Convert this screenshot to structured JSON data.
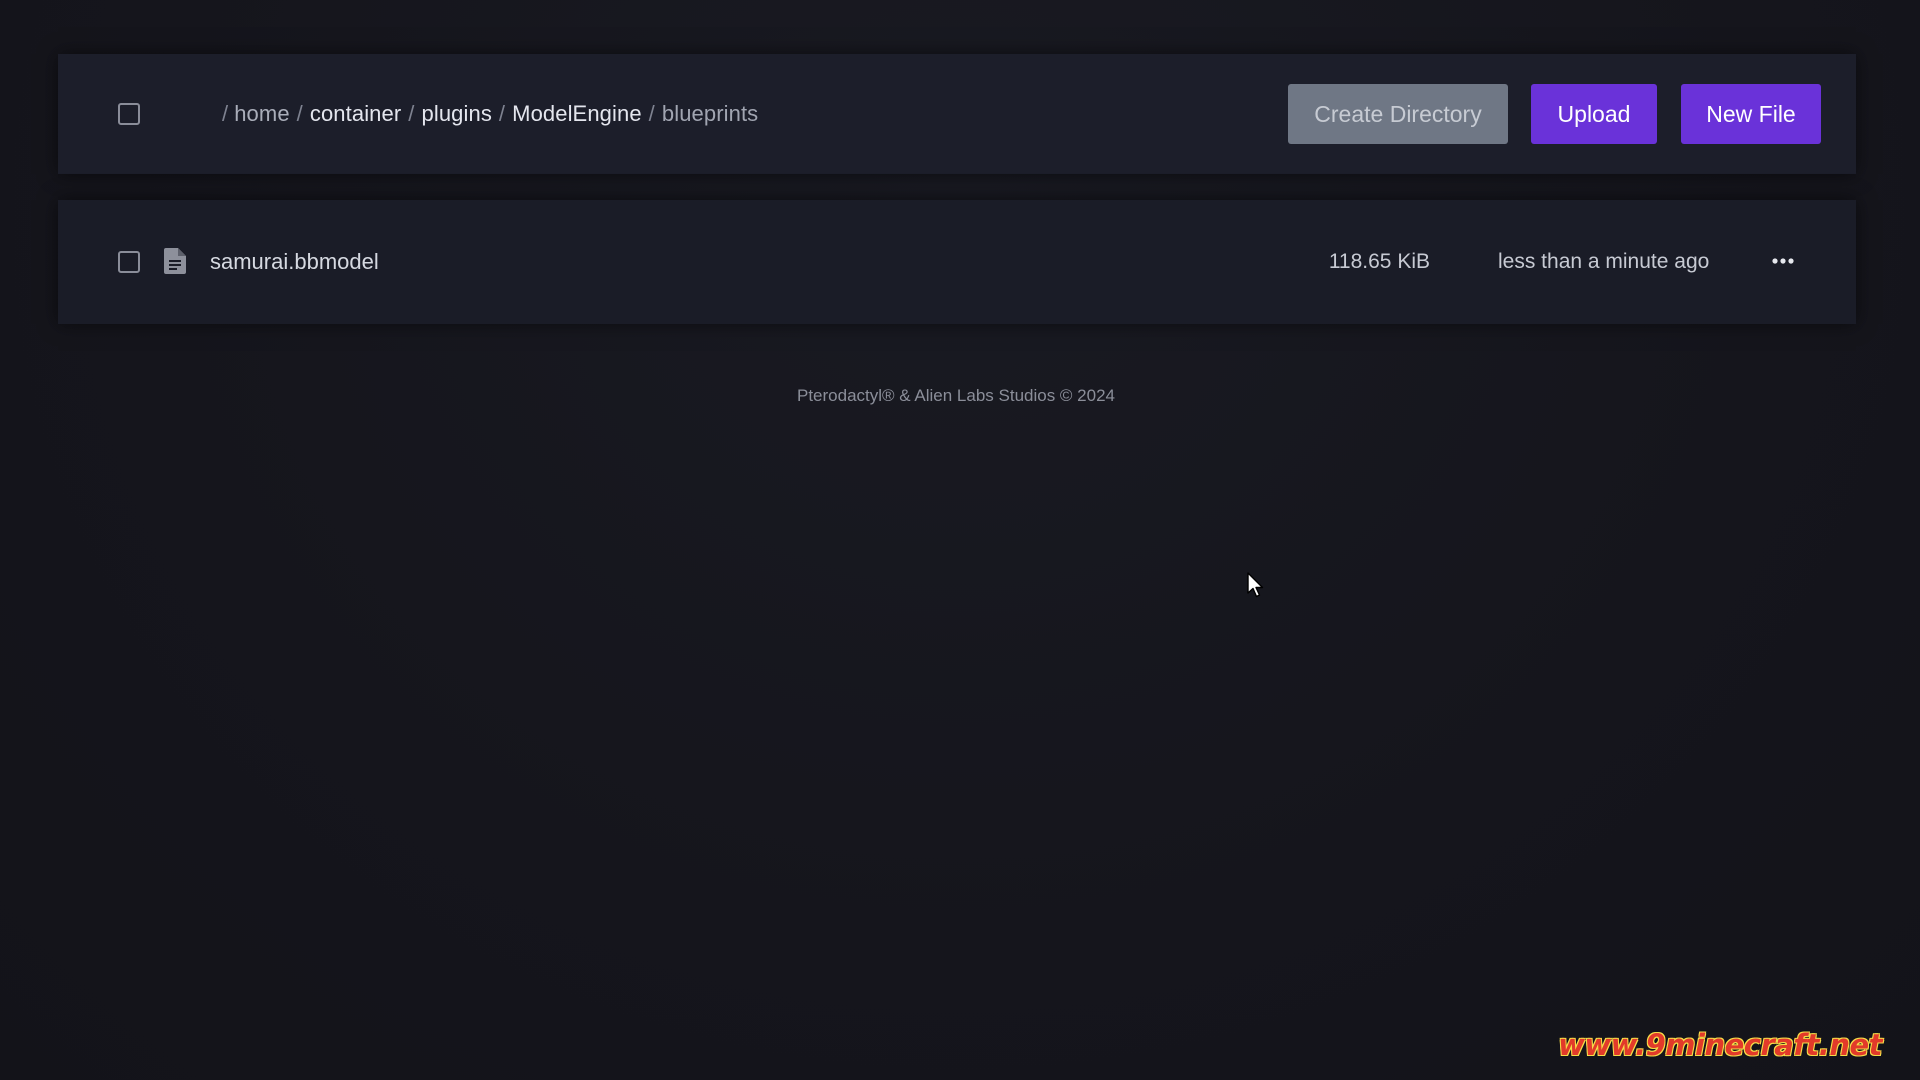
{
  "breadcrumb": {
    "root_sep": "/",
    "sep": "/",
    "parts": [
      "home",
      "container",
      "plugins",
      "ModelEngine",
      "blueprints"
    ]
  },
  "toolbar": {
    "create_directory_label": "Create Directory",
    "upload_label": "Upload",
    "new_file_label": "New File"
  },
  "files": [
    {
      "name": "samurai.bbmodel",
      "size": "118.65 KiB",
      "modified": "less than a minute ago",
      "icon": "file-text-icon"
    }
  ],
  "footer": {
    "text": "Pterodactyl® & Alien Labs Studios © 2024"
  },
  "watermark": {
    "text": "www.9minecraft.net"
  },
  "colors": {
    "background": "#16161d",
    "panel": "#1c1e2a",
    "primary_button": "#6a32d9",
    "secondary_button": "#6f7785"
  }
}
